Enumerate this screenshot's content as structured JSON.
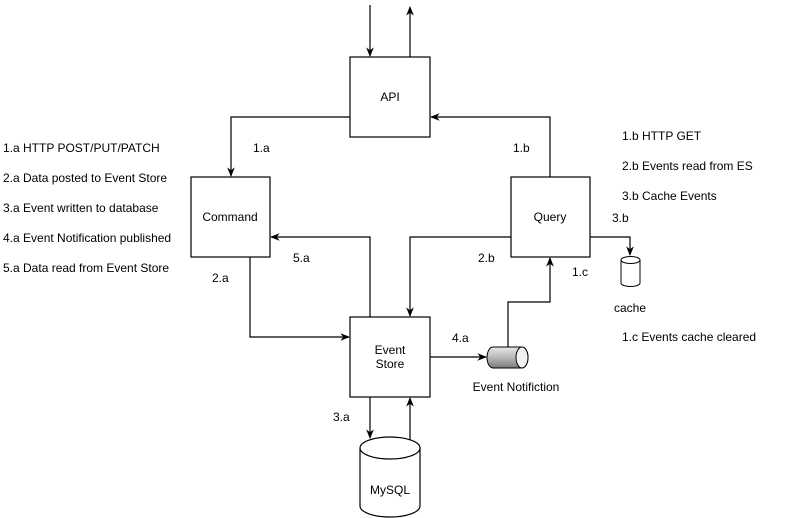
{
  "nodes": {
    "api": {
      "label": "API"
    },
    "command": {
      "label": "Command"
    },
    "query": {
      "label": "Query"
    },
    "event_store": {
      "line1": "Event",
      "line2": "Store"
    },
    "event_notification": {
      "label": "Event Notifiction"
    },
    "cache": {
      "label": "cache"
    },
    "mysql": {
      "label": "MySQL"
    }
  },
  "edges": {
    "e1a": "1.a",
    "e1b": "1.b",
    "e1c": "1.c",
    "e2a": "2.a",
    "e2b": "2.b",
    "e3a": "3.a",
    "e3b": "3.b",
    "e4a": "4.a",
    "e5a": "5.a"
  },
  "legend_left": [
    "1.a HTTP POST/PUT/PATCH",
    "2.a Data posted to Event Store",
    "3.a Event written to database",
    "4.a Event Notification published",
    "5.a Data read from Event Store"
  ],
  "legend_right": [
    "1.b HTTP GET",
    "2.b Events read from ES",
    "3.b Cache Events"
  ],
  "legend_right_bottom": "1.c Events cache cleared"
}
